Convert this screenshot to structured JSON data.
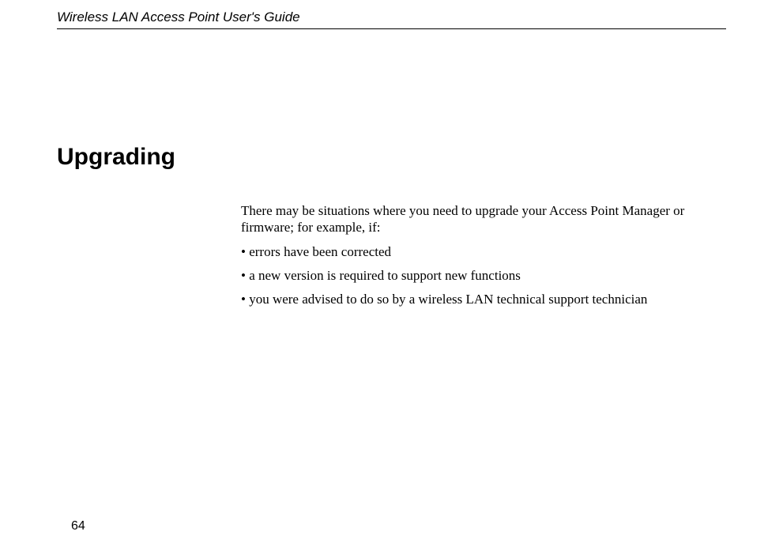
{
  "header": {
    "title": "Wireless LAN Access Point User's Guide"
  },
  "chapter": {
    "heading": "Upgrading"
  },
  "body": {
    "intro": "There may be situations where you need to upgrade your Access Point Manager or firmware; for example, if:",
    "bullet1": "• errors have been corrected",
    "bullet2": "• a new version is required to support new functions",
    "bullet3": "• you were advised to do so by a wireless LAN technical support technician"
  },
  "footer": {
    "page_number": "64"
  }
}
